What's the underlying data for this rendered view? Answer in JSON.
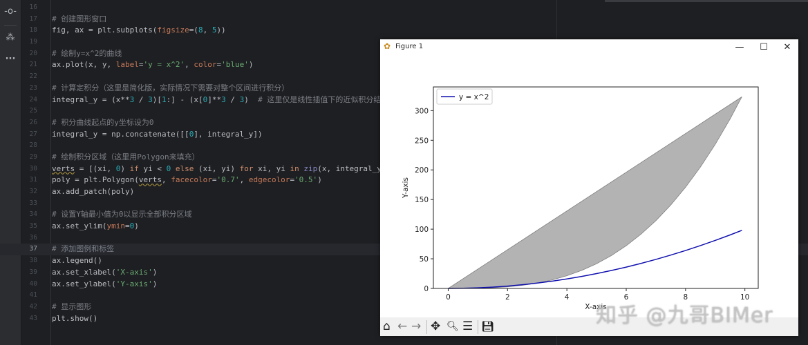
{
  "activity_bar": {
    "items": [
      {
        "icon": "commit-icon",
        "glyph": "-o-"
      },
      {
        "icon": "structure-icon",
        "glyph": "⁂"
      },
      {
        "icon": "more-icon",
        "glyph": "···"
      }
    ]
  },
  "editor": {
    "current_line": 37,
    "lines": [
      {
        "n": 16,
        "t": []
      },
      {
        "n": 17,
        "t": [
          [
            "# 创建图形窗口",
            "c"
          ]
        ]
      },
      {
        "n": 18,
        "t": [
          [
            "fig, ax = plt.subplots(",
            ""
          ],
          [
            "figsize",
            "p"
          ],
          [
            "=(",
            ""
          ],
          [
            "8",
            "n"
          ],
          [
            ", ",
            ""
          ],
          [
            "5",
            "n"
          ],
          [
            "))",
            ""
          ]
        ]
      },
      {
        "n": 19,
        "t": []
      },
      {
        "n": 20,
        "t": [
          [
            "# 绘制y=x^2的曲线",
            "c"
          ]
        ]
      },
      {
        "n": 21,
        "t": [
          [
            "ax.plot(x, y, ",
            ""
          ],
          [
            "label",
            "p"
          ],
          [
            "=",
            ""
          ],
          [
            "'y = x^2'",
            "s"
          ],
          [
            ", ",
            ""
          ],
          [
            "color",
            "p"
          ],
          [
            "=",
            ""
          ],
          [
            "'blue'",
            "s"
          ],
          [
            ")",
            ""
          ]
        ]
      },
      {
        "n": 22,
        "t": []
      },
      {
        "n": 23,
        "t": [
          [
            "# 计算定积分（这里是简化版，实际情况下需要对整个区间进行积分）",
            "c"
          ]
        ]
      },
      {
        "n": 24,
        "t": [
          [
            "integral_y = (x**",
            ""
          ],
          [
            "3",
            "n"
          ],
          [
            " / ",
            ""
          ],
          [
            "3",
            "n"
          ],
          [
            ")[",
            ""
          ],
          [
            "1",
            "n"
          ],
          [
            ":] - (x[",
            ""
          ],
          [
            "0",
            "n"
          ],
          [
            "]**",
            ""
          ],
          [
            "3",
            "n"
          ],
          [
            " / ",
            ""
          ],
          [
            "3",
            "n"
          ],
          [
            ")  ",
            ""
          ],
          [
            "# 这里仅是线性插值下的近似积分结果",
            "c"
          ]
        ]
      },
      {
        "n": 25,
        "t": []
      },
      {
        "n": 26,
        "t": [
          [
            "# 积分曲线起点的y坐标设为0",
            "c"
          ]
        ]
      },
      {
        "n": 27,
        "t": [
          [
            "integral_y = np.concatenate([[",
            ""
          ],
          [
            "0",
            "n"
          ],
          [
            "], integral_y])",
            ""
          ]
        ]
      },
      {
        "n": 28,
        "t": []
      },
      {
        "n": 29,
        "t": [
          [
            "# 绘制积分区域（这里用Polygon来填充）",
            "c"
          ]
        ]
      },
      {
        "n": 30,
        "t": [
          [
            "verts",
            "u"
          ],
          [
            " = [(xi, ",
            ""
          ],
          [
            "0",
            "n"
          ],
          [
            ") ",
            ""
          ],
          [
            "if",
            "k"
          ],
          [
            " yi < ",
            ""
          ],
          [
            "0",
            "n"
          ],
          [
            " ",
            ""
          ],
          [
            "else",
            "k"
          ],
          [
            " (xi, yi) ",
            ""
          ],
          [
            "for",
            "k"
          ],
          [
            " xi, yi ",
            ""
          ],
          [
            "in",
            "k"
          ],
          [
            " ",
            ""
          ],
          [
            "zip",
            "b"
          ],
          [
            "(x, integral_y)]",
            ""
          ]
        ]
      },
      {
        "n": 31,
        "t": [
          [
            "poly = plt.Polygon(",
            ""
          ],
          [
            "verts",
            "u"
          ],
          [
            ", ",
            ""
          ],
          [
            "facecolor",
            "p"
          ],
          [
            "=",
            ""
          ],
          [
            "'0.7'",
            "s"
          ],
          [
            ", ",
            ""
          ],
          [
            "edgecolor",
            "p"
          ],
          [
            "=",
            ""
          ],
          [
            "'0.5'",
            "s"
          ],
          [
            ")",
            ""
          ]
        ]
      },
      {
        "n": 32,
        "t": [
          [
            "ax.add_patch(poly)",
            ""
          ]
        ]
      },
      {
        "n": 33,
        "t": []
      },
      {
        "n": 34,
        "t": [
          [
            "# 设置Y轴最小值为0以显示全部积分区域",
            "c"
          ]
        ]
      },
      {
        "n": 35,
        "t": [
          [
            "ax.set_ylim(",
            ""
          ],
          [
            "ymin",
            "p"
          ],
          [
            "=",
            ""
          ],
          [
            "0",
            "n"
          ],
          [
            ")",
            ""
          ]
        ]
      },
      {
        "n": 36,
        "t": []
      },
      {
        "n": 37,
        "t": [
          [
            "# 添加图例和标签",
            "c"
          ]
        ]
      },
      {
        "n": 38,
        "t": [
          [
            "ax.legend()",
            ""
          ]
        ]
      },
      {
        "n": 39,
        "t": [
          [
            "ax.set_xlabel(",
            ""
          ],
          [
            "'X-axis'",
            "s"
          ],
          [
            ")",
            ""
          ]
        ]
      },
      {
        "n": 40,
        "t": [
          [
            "ax.set_ylabel(",
            ""
          ],
          [
            "'Y-axis'",
            "s"
          ],
          [
            ")",
            ""
          ]
        ]
      },
      {
        "n": 41,
        "t": []
      },
      {
        "n": 42,
        "t": [
          [
            "# 显示图形",
            "c"
          ]
        ]
      },
      {
        "n": 43,
        "t": [
          [
            "plt.show()",
            ""
          ]
        ]
      }
    ]
  },
  "figure_window": {
    "title": "Figure 1",
    "minimize": "—",
    "maximize": "☐",
    "close": "✕",
    "toolbar": [
      {
        "name": "home-icon",
        "glyph": "⌂"
      },
      {
        "name": "back-icon",
        "glyph": "←"
      },
      {
        "name": "forward-icon",
        "glyph": "→"
      },
      {
        "name": "pan-icon",
        "glyph": "✥"
      },
      {
        "name": "zoom-icon",
        "glyph": "🔍︎"
      },
      {
        "name": "configure-icon",
        "glyph": "☰"
      },
      {
        "name": "save-icon",
        "glyph": "💾︎"
      }
    ]
  },
  "watermark": "知乎 @九哥BIMer",
  "chart_data": {
    "type": "line",
    "xlabel": "X-axis",
    "ylabel": "Y-axis",
    "xlim": [
      -0.5,
      10.45
    ],
    "ylim": [
      0,
      340
    ],
    "xticks": [
      0,
      2,
      4,
      6,
      8,
      10
    ],
    "yticks": [
      0,
      50,
      100,
      150,
      200,
      250,
      300
    ],
    "grid": false,
    "legend": {
      "placement": "upper-left",
      "entries": [
        "y = x^2"
      ]
    },
    "x": [
      0,
      0.5,
      1,
      1.5,
      2,
      2.5,
      3,
      3.5,
      4,
      4.5,
      5,
      5.5,
      6,
      6.5,
      7,
      7.5,
      8,
      8.5,
      9,
      9.5,
      9.9
    ],
    "series": [
      {
        "name": "y = x^2",
        "color": "#0000ff",
        "values": [
          0,
          0.25,
          1,
          2.25,
          4,
          6.25,
          9,
          12.25,
          16,
          20.25,
          25,
          30.25,
          36,
          42.25,
          49,
          56.25,
          64,
          72.25,
          81,
          90.25,
          98.01
        ]
      }
    ],
    "polygon": {
      "facecolor": "#b3b3b3",
      "edgecolor": "#808080",
      "values": [
        0,
        0.04,
        0.33,
        1.13,
        2.67,
        5.21,
        9,
        14.29,
        21.33,
        30.38,
        41.67,
        55.46,
        72,
        91.55,
        114.33,
        140.63,
        170.67,
        204.71,
        243,
        285.79,
        323.43
      ]
    }
  }
}
